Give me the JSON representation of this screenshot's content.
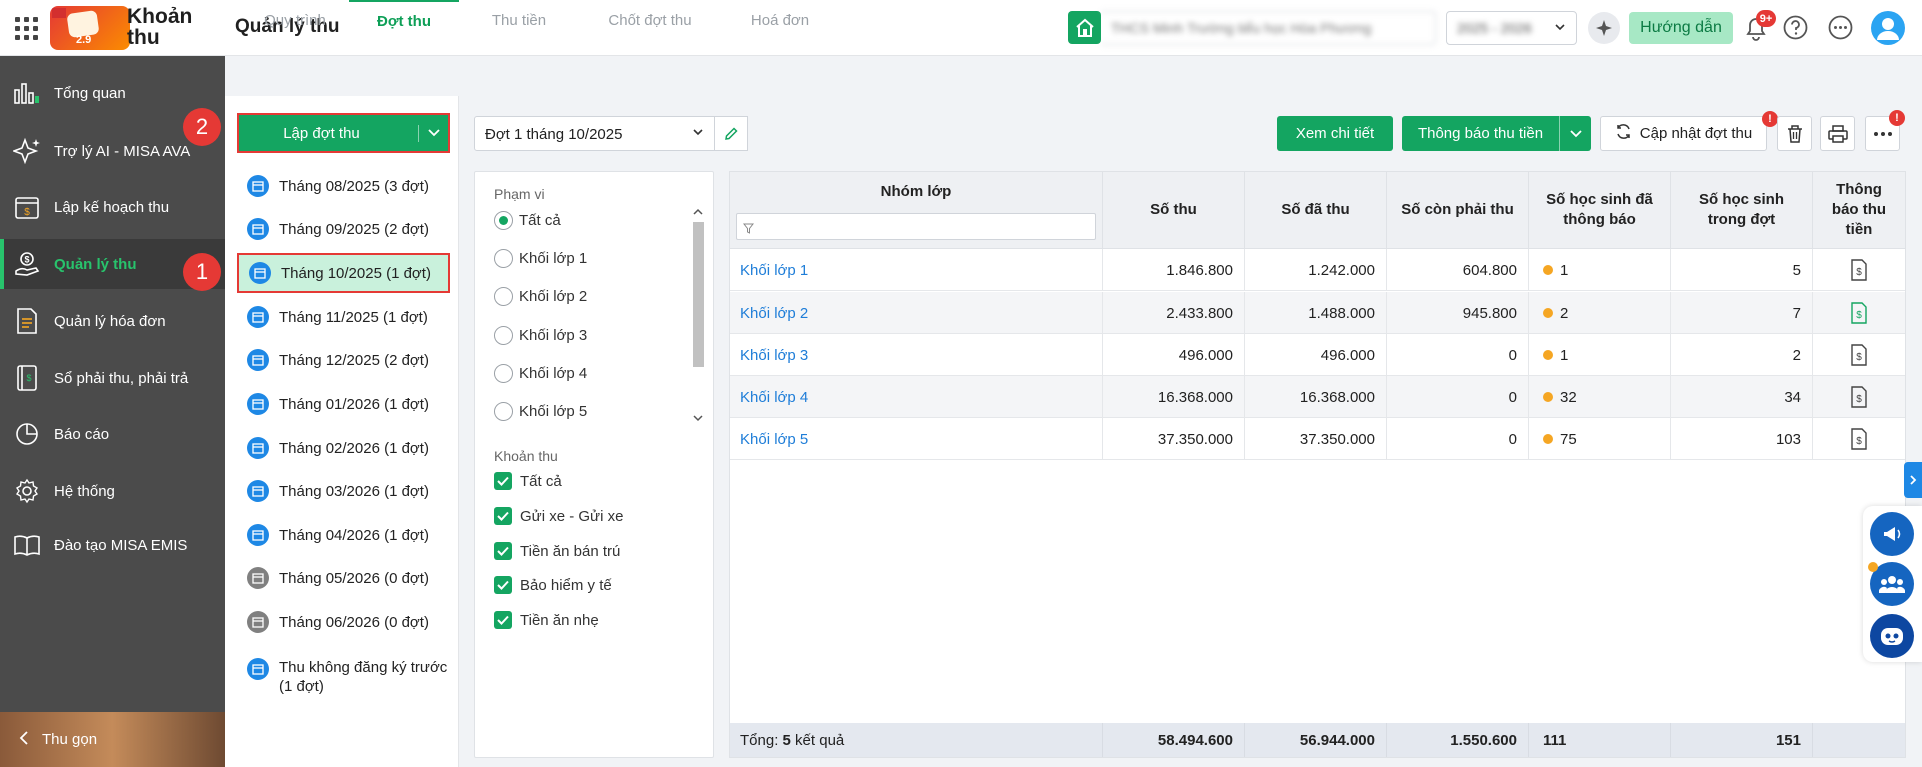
{
  "header": {
    "brand": "Khoản thu",
    "logo_year": "2.9",
    "page_title": "Quản lý thu",
    "school_name": "THCS Minh Trường tiểu học Hòa Phương",
    "school_year": "2025 - 2026",
    "guide_label": "Hướng dẫn",
    "notif_badge": "9+"
  },
  "sidebar": {
    "items": [
      {
        "label": "Tổng quan",
        "icon": "bar-chart-icon"
      },
      {
        "label": "Trợ lý AI - MISA AVA",
        "icon": "sparkle-icon"
      },
      {
        "label": "Lập kế hoạch thu",
        "icon": "calendar-money-icon"
      },
      {
        "label": "Quản lý thu",
        "icon": "hand-money-icon"
      },
      {
        "label": "Quản lý hóa đơn",
        "icon": "invoice-icon"
      },
      {
        "label": "Sổ phải thu, phải trả",
        "icon": "ledger-icon"
      },
      {
        "label": "Báo cáo",
        "icon": "pie-chart-icon"
      },
      {
        "label": "Hệ thống",
        "icon": "gear-icon"
      },
      {
        "label": "Đào tạo MISA EMIS",
        "icon": "book-icon"
      }
    ],
    "active_index": 3,
    "collapse_label": "Thu gọn"
  },
  "tabs": [
    {
      "label": "Quy trình"
    },
    {
      "label": "Đợt thu"
    },
    {
      "label": "Thu tiền"
    },
    {
      "label": "Chốt đợt thu"
    },
    {
      "label": "Hoá đơn"
    }
  ],
  "periods": {
    "create_label": "Lập đợt thu",
    "items": [
      "Tháng 08/2025 (3 đợt)",
      "Tháng 09/2025 (2 đợt)",
      "Tháng 10/2025 (1 đợt)",
      "Tháng 11/2025 (1 đợt)",
      "Tháng 12/2025 (2 đợt)",
      "Tháng 01/2026 (1 đợt)",
      "Tháng 02/2026 (1 đợt)",
      "Tháng 03/2026 (1 đợt)",
      "Tháng 04/2026 (1 đợt)",
      "Tháng 05/2026 (0 đợt)",
      "Tháng 06/2026 (0 đợt)",
      "Thu không đăng ký trước (1 đợt)"
    ],
    "active_index": 2,
    "step1": "1",
    "step2": "2"
  },
  "toolbar": {
    "period_value": "Đợt 1 tháng 10/2025",
    "detail_label": "Xem chi tiết",
    "notify_label": "Thông báo thu tiền",
    "update_label": "Cập nhật đợt thu",
    "alert": "!"
  },
  "filter": {
    "scope_title": "Phạm vi",
    "scope": [
      "Tất cả",
      "Khối lớp 1",
      "Khối lớp 2",
      "Khối lớp 3",
      "Khối lớp 4",
      "Khối lớp 5"
    ],
    "scope_selected": 0,
    "fee_title": "Khoản thu",
    "fees": [
      "Tất cả",
      "Gửi xe - Gửi xe",
      "Tiền ăn bán trú",
      "Bảo hiểm y tế",
      "Tiền ăn nhẹ"
    ]
  },
  "table": {
    "columns": [
      "Nhóm lớp",
      "Số thu",
      "Số đã thu",
      "Số còn phải thu",
      "Số học sinh đã thông báo",
      "Số học sinh trong đợt",
      "Thông báo thu tiền"
    ],
    "rows": [
      {
        "group": "Khối lớp 1",
        "total": "1.846.800",
        "paid": "1.242.000",
        "remaining": "604.800",
        "notified": "1",
        "students": "5"
      },
      {
        "group": "Khối lớp 2",
        "total": "2.433.800",
        "paid": "1.488.000",
        "remaining": "945.800",
        "notified": "2",
        "students": "7"
      },
      {
        "group": "Khối lớp 3",
        "total": "496.000",
        "paid": "496.000",
        "remaining": "0",
        "notified": "1",
        "students": "2"
      },
      {
        "group": "Khối lớp 4",
        "total": "16.368.000",
        "paid": "16.368.000",
        "remaining": "0",
        "notified": "32",
        "students": "34"
      },
      {
        "group": "Khối lớp 5",
        "total": "37.350.000",
        "paid": "37.350.000",
        "remaining": "0",
        "notified": "75",
        "students": "103"
      }
    ],
    "footer": {
      "label_prefix": "Tổng: ",
      "count": "5",
      "label_suffix": " kết quả",
      "total": "58.494.600",
      "paid": "56.944.000",
      "remaining": "1.550.600",
      "notified": "111",
      "students": "151"
    }
  },
  "colors": {
    "primary": "#14a561",
    "sidebar_bg": "#4b4b4b",
    "link": "#1e7dd8",
    "alert": "#e53935",
    "status_dot": "#f5a623"
  }
}
